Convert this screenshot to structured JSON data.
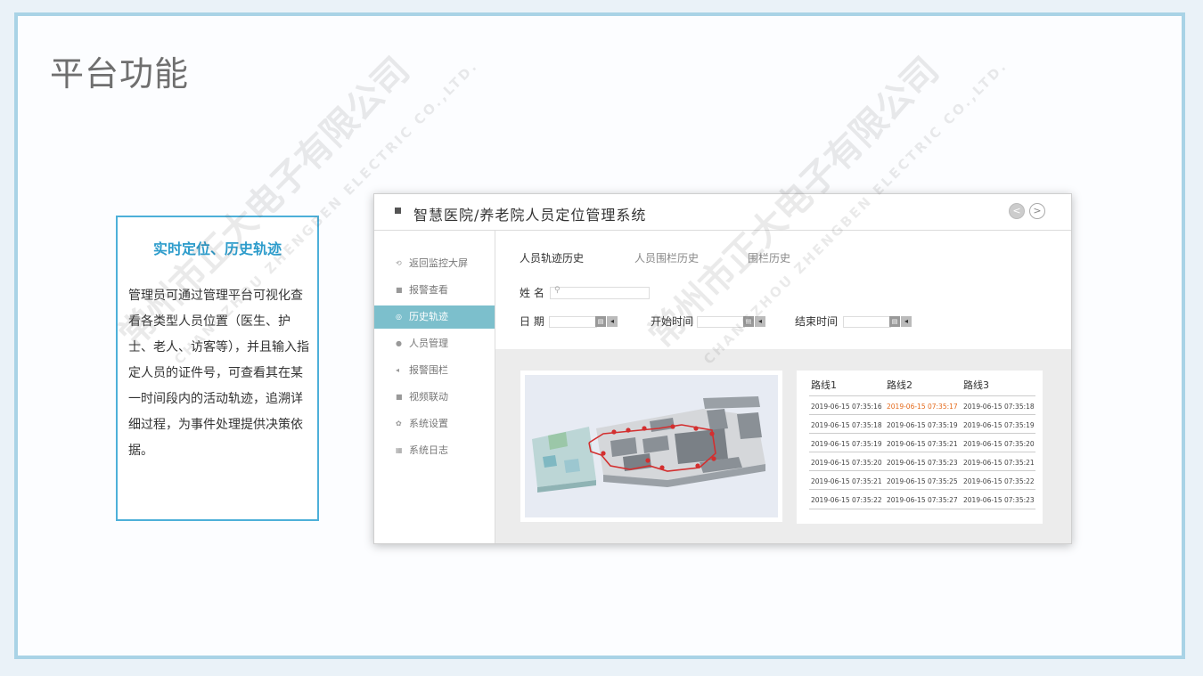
{
  "slide": {
    "title": "平台功能",
    "feature": {
      "title": "实时定位、历史轨迹",
      "description": "管理员可通过管理平台可视化查看各类型人员位置（医生、护士、老人、访客等），并且输入指定人员的证件号，可查看其在某一时间段内的活动轨迹，追溯详细过程，为事件处理提供决策依据。"
    }
  },
  "watermark": {
    "company": "常州市正大电子有限公司",
    "company_en": "CHANGZHOU ZHENGBEN ELECTRIC CO.,LTD."
  },
  "app": {
    "title": "智慧医院/养老院人员定位管理系统",
    "nav": {
      "prev": "<",
      "next": ">"
    },
    "sidebar": [
      {
        "label": "返回监控大屏",
        "icon": "back-icon",
        "glyph": "⟲"
      },
      {
        "label": "报警查看",
        "icon": "alarm-icon",
        "glyph": "■"
      },
      {
        "label": "历史轨迹",
        "icon": "track-icon",
        "glyph": "◎",
        "active": true
      },
      {
        "label": "人员管理",
        "icon": "user-icon",
        "glyph": "●"
      },
      {
        "label": "报警围栏",
        "icon": "fence-icon",
        "glyph": "◂"
      },
      {
        "label": "视频联动",
        "icon": "video-icon",
        "glyph": "■"
      },
      {
        "label": "系统设置",
        "icon": "gear-icon",
        "glyph": "✿"
      },
      {
        "label": "系统日志",
        "icon": "log-icon",
        "glyph": "▦"
      }
    ],
    "tabs": [
      {
        "label": "人员轨迹历史",
        "active": true
      },
      {
        "label": "人员围栏历史"
      },
      {
        "label": "围栏历史"
      }
    ],
    "form": {
      "name_label": "姓 名",
      "name_value": "",
      "date_label": "日 期",
      "start_label": "开始时间",
      "end_label": "结束时间",
      "calendar_glyph": "▤",
      "arrow_glyph": "◂",
      "search_glyph": "⚲"
    },
    "routes": {
      "headers": [
        "路线1",
        "路线2",
        "路线3"
      ],
      "rows": [
        [
          "2019-06-15  07:35:16",
          "2019-06-15  07:35:17",
          "2019-06-15  07:35:18"
        ],
        [
          "2019-06-15  07:35:18",
          "2019-06-15  07:35:19",
          "2019-06-15  07:35:19"
        ],
        [
          "2019-06-15  07:35:19",
          "2019-06-15  07:35:21",
          "2019-06-15  07:35:20"
        ],
        [
          "2019-06-15  07:35:20",
          "2019-06-15  07:35:23",
          "2019-06-15  07:35:21"
        ],
        [
          "2019-06-15  07:35:21",
          "2019-06-15  07:35:25",
          "2019-06-15  07:35:22"
        ],
        [
          "2019-06-15  07:35:22",
          "2019-06-15  07:35:27",
          "2019-06-15  07:35:23"
        ]
      ],
      "highlight_color": "#e46a1c"
    },
    "colors": {
      "accent": "#2d9ccb",
      "sidebar_active": "#7cbfcc",
      "route_line": "#d32f2f",
      "frame": "#a9d3e6"
    }
  }
}
